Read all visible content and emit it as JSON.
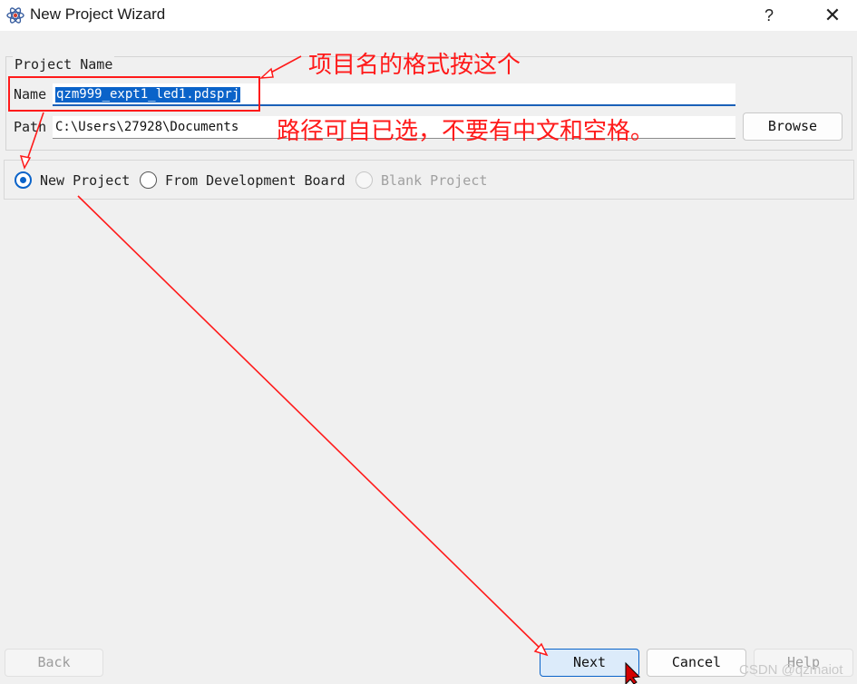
{
  "window": {
    "title": "New Project Wizard",
    "help_label": "?",
    "close_label": "✕",
    "icon": "atom-icon"
  },
  "group": {
    "title": "Project Name",
    "name_label": "Name",
    "name_value": "qzm999_expt1_led1.pdsprj",
    "path_label": "Path",
    "path_value": "C:\\Users\\27928\\Documents",
    "browse_label": "Browse"
  },
  "radios": {
    "new_project": "New Project",
    "from_board": "From Development Board",
    "blank_project": "Blank Project",
    "selected": "New Project"
  },
  "buttons": {
    "back": "Back",
    "next": "Next",
    "cancel": "Cancel",
    "help": "Help"
  },
  "annotations": {
    "name_note": "项目名的格式按这个",
    "path_note": "路径可自已选，不要有中文和空格。",
    "color": "#ff1a1a"
  },
  "watermark": "CSDN @qzmaiot",
  "colors": {
    "accent": "#0a63c9",
    "background": "#f0f0f0"
  }
}
